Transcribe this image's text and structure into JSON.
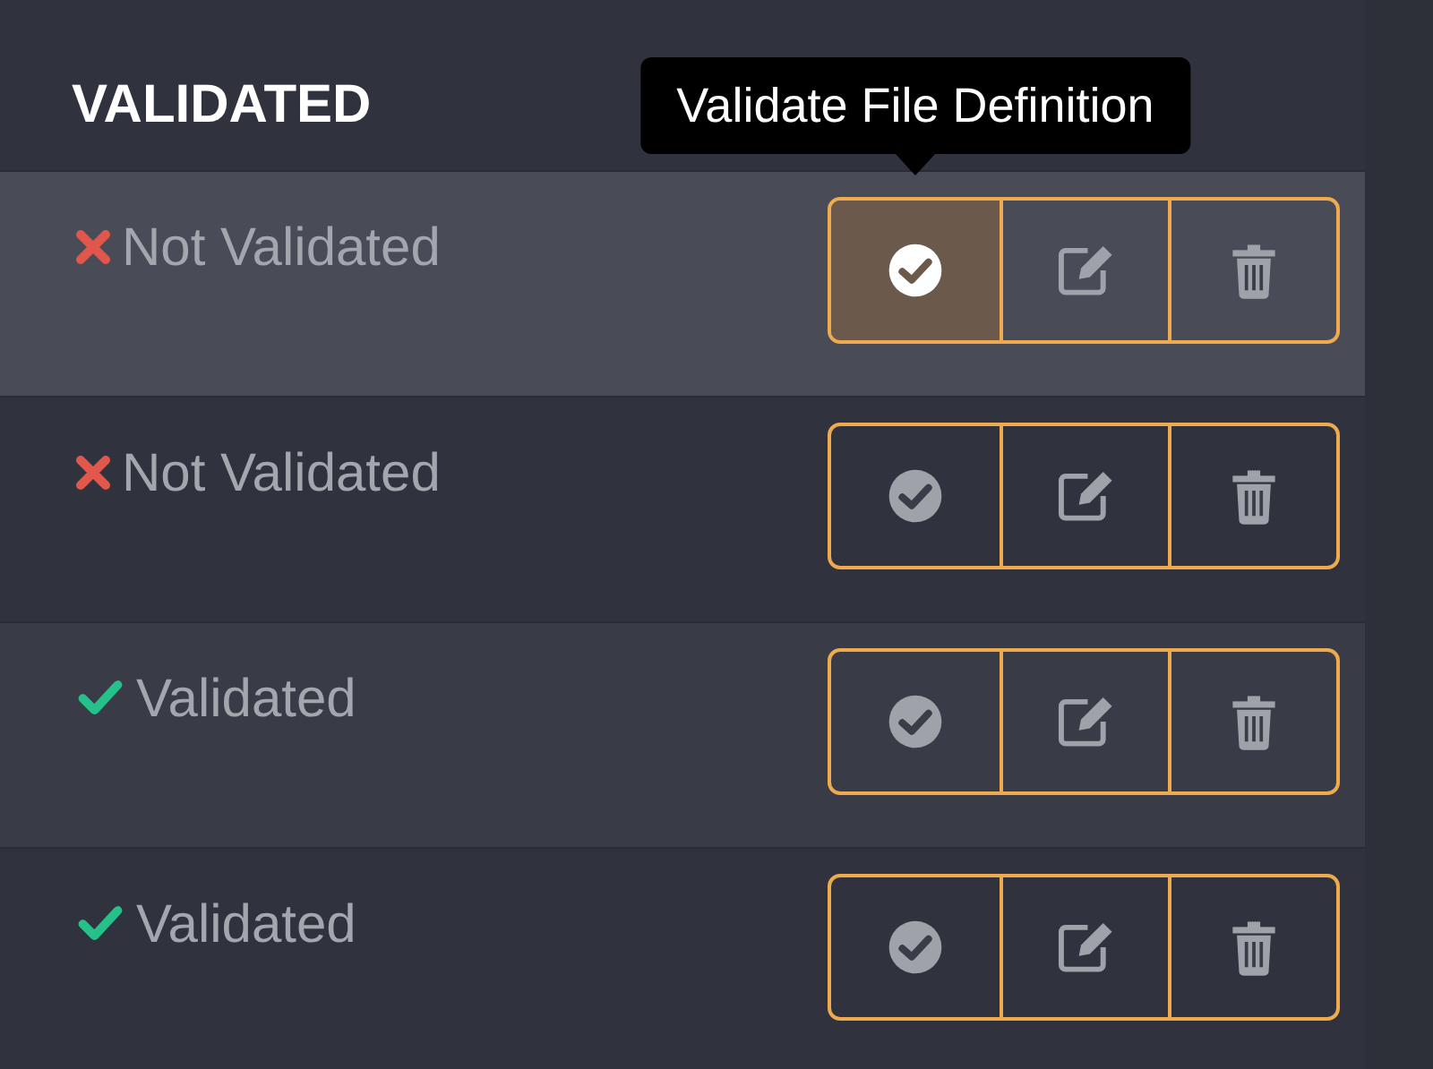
{
  "header": {
    "title": "VALIDATED"
  },
  "tooltip": "Validate File Definition",
  "rows": [
    {
      "validated": false,
      "label": "Not Validated",
      "hovered": true
    },
    {
      "validated": false,
      "label": "Not Validated",
      "hovered": false
    },
    {
      "validated": true,
      "label": "Validated",
      "hovered": false
    },
    {
      "validated": true,
      "label": "Validated",
      "hovered": false
    }
  ]
}
